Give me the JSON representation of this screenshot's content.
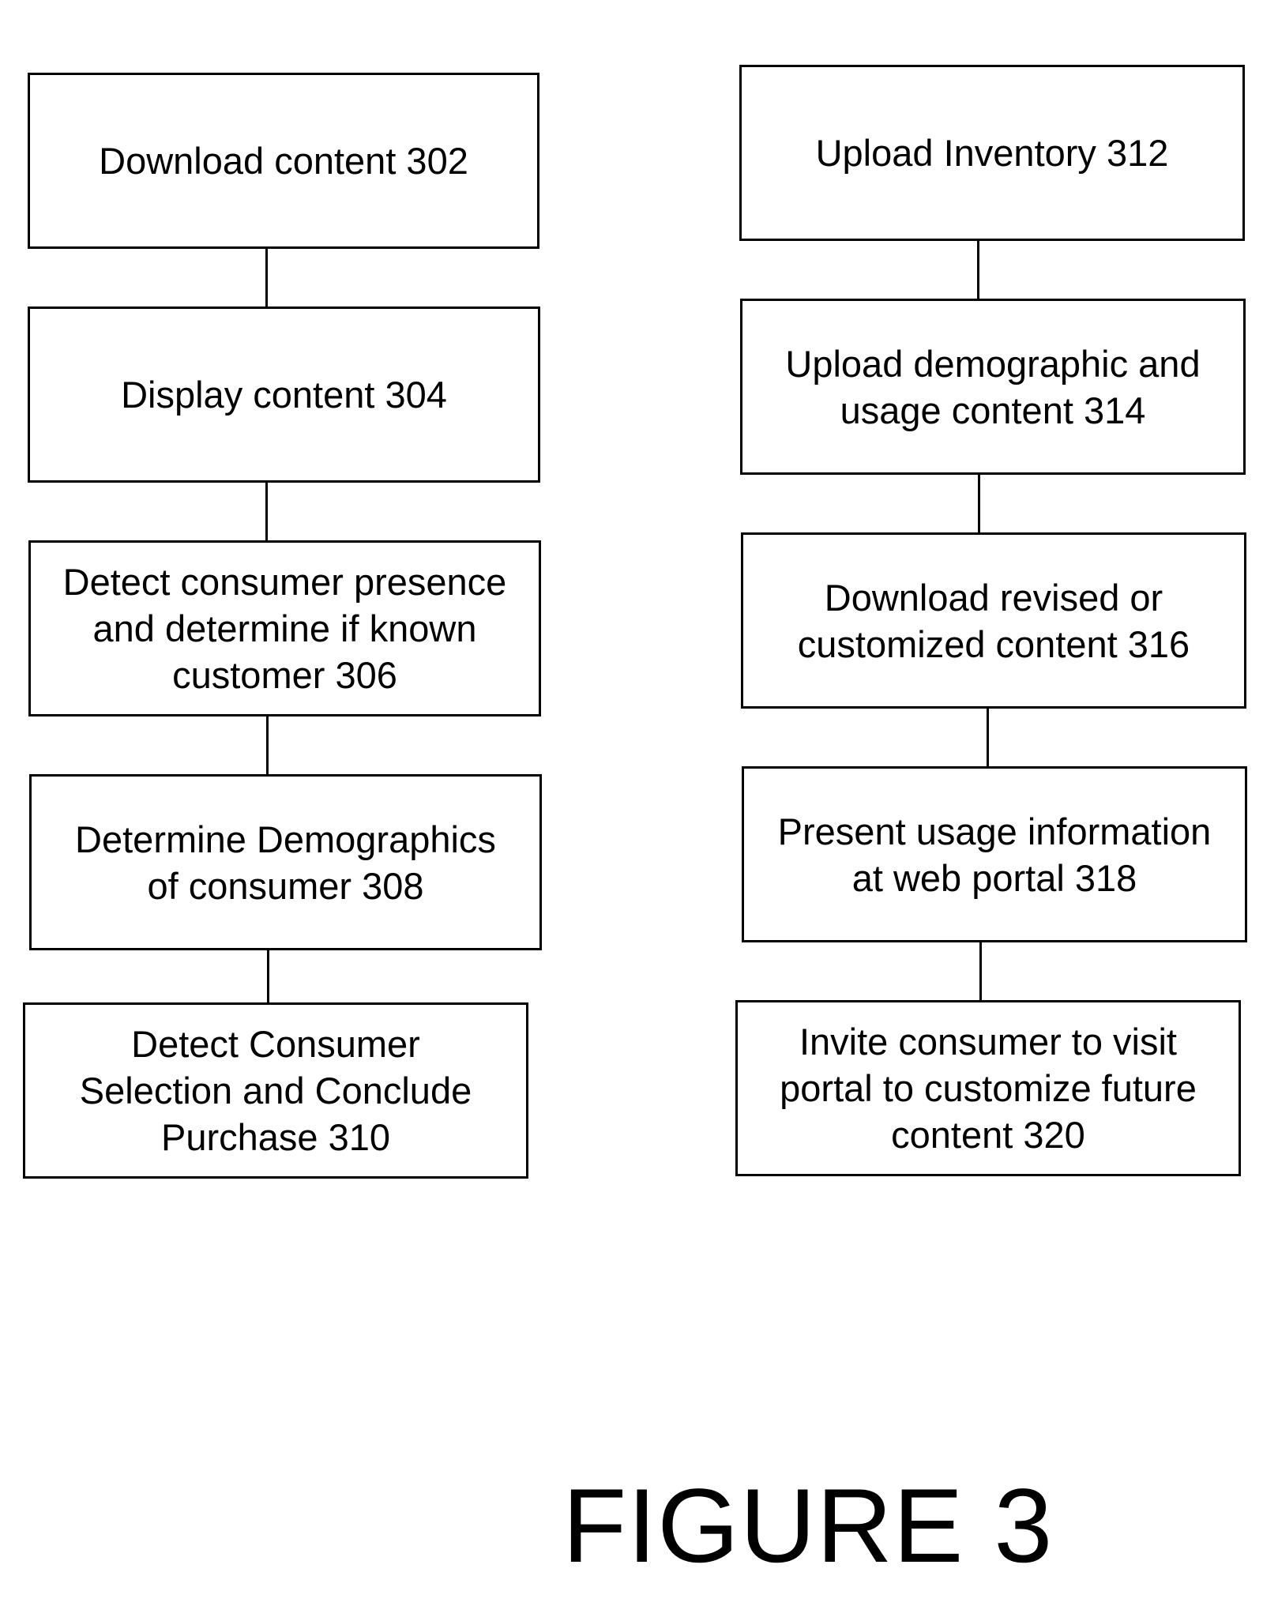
{
  "figure": {
    "title": "FIGURE 3"
  },
  "left_column": {
    "steps": [
      {
        "id": "302",
        "label": "Download content 302"
      },
      {
        "id": "304",
        "label": "Display content 304"
      },
      {
        "id": "306",
        "label": "Detect consumer presence\nand determine if known\ncustomer 306"
      },
      {
        "id": "308",
        "label": "Determine Demographics\nof consumer 308"
      },
      {
        "id": "310",
        "label": "Detect Consumer\nSelection and Conclude\nPurchase  310"
      }
    ]
  },
  "right_column": {
    "steps": [
      {
        "id": "312",
        "label": "Upload Inventory 312"
      },
      {
        "id": "314",
        "label": "Upload demographic and\nusage content 314"
      },
      {
        "id": "316",
        "label": "Download revised or\ncustomized content 316"
      },
      {
        "id": "318",
        "label": "Present usage information\nat web portal 318"
      },
      {
        "id": "320",
        "label": "Invite consumer to visit\nportal to customize future\ncontent 320"
      }
    ]
  }
}
